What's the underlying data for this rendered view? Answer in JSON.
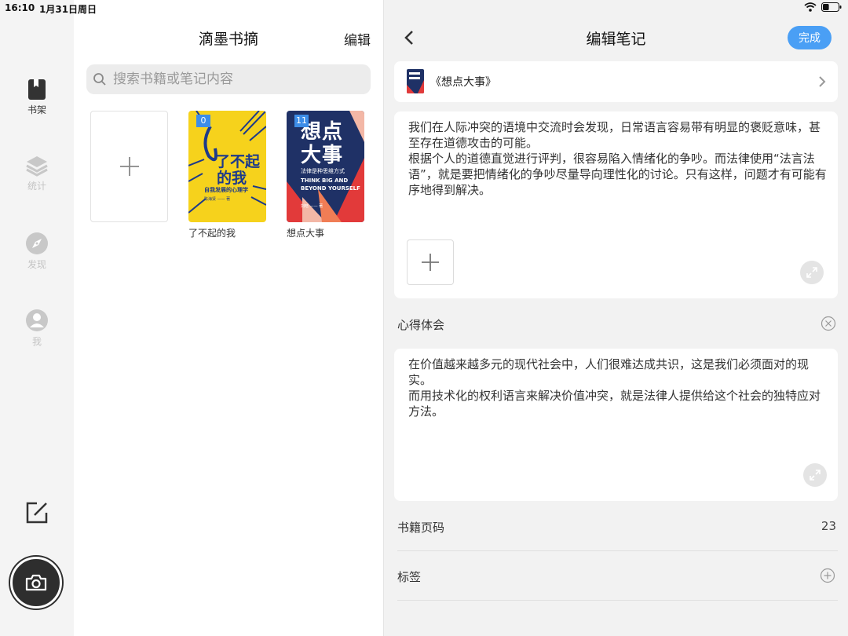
{
  "status_bar": {
    "time": "16:10",
    "date": "1月31日周日",
    "battery_level": 0.4
  },
  "nav": {
    "items": [
      {
        "label": "书架",
        "icon": "bookshelf-icon",
        "active": true
      },
      {
        "label": "统计",
        "icon": "layers-icon",
        "active": false
      },
      {
        "label": "发现",
        "icon": "compass-icon",
        "active": false
      },
      {
        "label": "我",
        "icon": "person-icon",
        "active": false
      }
    ],
    "compose_icon": "compose-icon",
    "camera_icon": "camera-icon"
  },
  "library": {
    "title": "滴墨书摘",
    "edit_label": "编辑",
    "search_placeholder": "搜索书籍或笔记内容",
    "add_icon": "plus-icon",
    "books": [
      {
        "title": "了不起的我",
        "note_count": "0",
        "cover_title_line1": "了不起",
        "cover_title_line2": "的我",
        "cover_subtitle": "自我发展的心理学",
        "cover_author": "陈海贤 —— 著",
        "cover_color": "#f6d21c"
      },
      {
        "title": "想点大事",
        "note_count": "11",
        "cover_title_line1": "想点",
        "cover_title_line2": "大事",
        "cover_subtitle": "法律是种思维方式",
        "cover_en_line1": "THINK BIG AND",
        "cover_en_line2": "BEYOND YOURSELF",
        "cover_author": "刘晗 —— 著",
        "cover_color": "#1f3166"
      }
    ]
  },
  "editor": {
    "title": "编辑笔记",
    "done_label": "完成",
    "book_ref": "《想点大事》",
    "excerpt": "我们在人际冲突的语境中交流时会发现，日常语言容易带有明显的褒贬意味，甚至存在道德攻击的可能。\n根据个人的道德直觉进行评判，很容易陷入情绪化的争吵。而法律使用“法言法语”，就是要把情绪化的争吵尽量导向理性化的讨论。只有这样，问题才有可能有序地得到解决。",
    "reflection_label": "心得体会",
    "reflection": "在价值越来越多元的现代社会中，人们很难达成共识，这是我们必须面对的现实。\n而用技术化的权利语言来解决价值冲突，就是法律人提供给这个社会的独特应对方法。",
    "page_label": "书籍页码",
    "page_value": "23",
    "tag_label": "标签"
  },
  "colors": {
    "accent": "#4a9ff5",
    "count_badge": "#3d8de8",
    "camera_button": "#2e2e2e"
  }
}
